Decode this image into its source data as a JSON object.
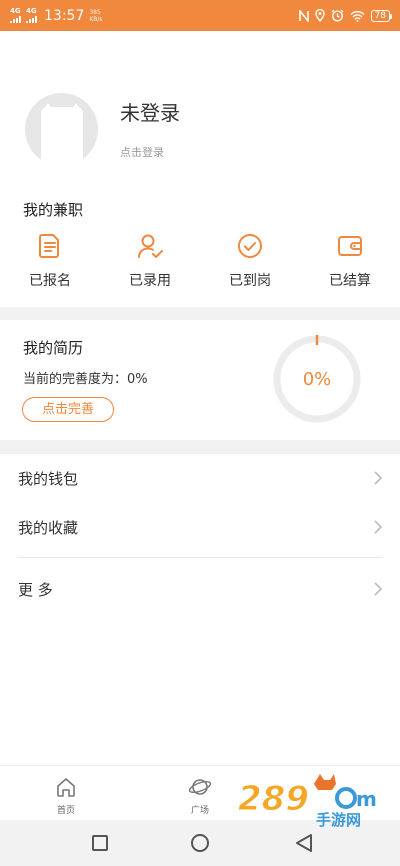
{
  "status_bar": {
    "network_1": "4G",
    "network_2": "4G",
    "time": "13:57",
    "speed_value": "385",
    "speed_unit": "KB/s",
    "battery": "78"
  },
  "profile": {
    "name": "未登录",
    "login_hint": "点击登录"
  },
  "part_time": {
    "title": "我的兼职",
    "items": [
      {
        "label": "已报名",
        "icon": "document-icon"
      },
      {
        "label": "已录用",
        "icon": "user-check-icon"
      },
      {
        "label": "已到岗",
        "icon": "check-circle-icon"
      },
      {
        "label": "已结算",
        "icon": "wallet-icon"
      }
    ]
  },
  "resume": {
    "title": "我的简历",
    "progress_text": "当前的完善度为：0%",
    "button_label": "点击完善",
    "progress_percent": "0%",
    "progress_value": 0
  },
  "menu": {
    "wallet": "我的钱包",
    "favorites": "我的收藏",
    "more": "更 多"
  },
  "tabs": [
    {
      "label": "首页",
      "icon": "home-icon"
    },
    {
      "label": "广场",
      "icon": "planet-icon"
    }
  ],
  "watermark": {
    "line1": "289",
    "line2": "手游网"
  },
  "colors": {
    "accent": "#f0883e",
    "band": "#f2f2f2",
    "ring_track": "#ececec"
  }
}
